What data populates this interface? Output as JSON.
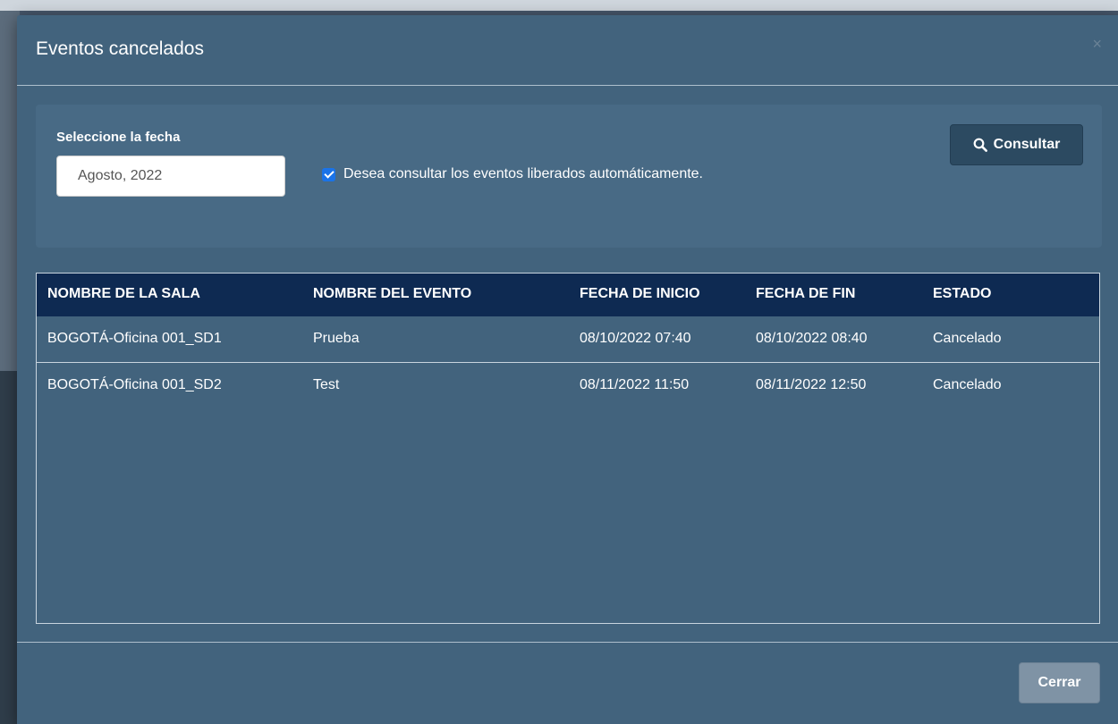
{
  "modal": {
    "title": "Eventos cancelados",
    "close_symbol": "×"
  },
  "filter": {
    "date_label": "Seleccione la fecha",
    "date_value": "Agosto, 2022",
    "auto_released_checked": true,
    "auto_released_label": "Desea consultar los eventos liberados automáticamente.",
    "consult_button_label": "Consultar",
    "consult_button_icon": "search-icon"
  },
  "table": {
    "columns": [
      "NOMBRE DE LA SALA",
      "NOMBRE DEL EVENTO",
      "FECHA DE INICIO",
      "FECHA DE FIN",
      "ESTADO"
    ],
    "rows": [
      [
        "BOGOTÁ-Oficina 001_SD1",
        "Prueba",
        "08/10/2022 07:40",
        "08/10/2022 08:40",
        "Cancelado"
      ],
      [
        "BOGOTÁ-Oficina 001_SD2",
        "Test",
        "08/11/2022 11:50",
        "08/11/2022 12:50",
        "Cancelado"
      ]
    ]
  },
  "footer": {
    "close_button_label": "Cerrar"
  },
  "colors": {
    "modal_bg": "#42637d",
    "table_header_bg": "#0e2a52",
    "checkbox_accent": "#1a73e8"
  }
}
